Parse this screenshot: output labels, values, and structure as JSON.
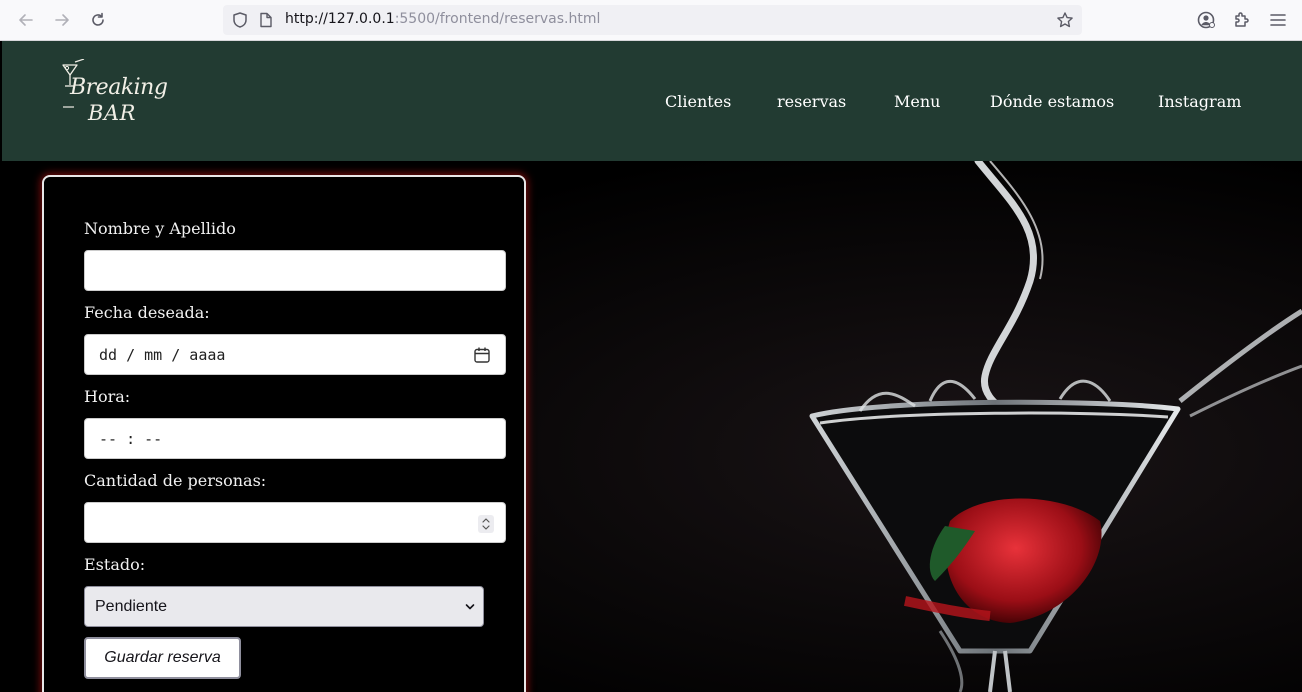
{
  "browser": {
    "url_host": "http://127.0.0.1",
    "url_path": ":5500/frontend/reservas.html"
  },
  "header": {
    "logo": {
      "line1": "Breaking",
      "line2": "BAR"
    },
    "nav": [
      "Clientes",
      "reservas",
      "Menu",
      "Dónde estamos",
      "Instagram"
    ]
  },
  "form": {
    "name_label": "Nombre y Apellido",
    "name_value": "",
    "date_label": "Fecha deseada:",
    "date_placeholder": "dd / mm / aaaa",
    "time_label": "Hora:",
    "time_placeholder": "-- : --",
    "people_label": "Cantidad de personas:",
    "people_value": "",
    "status_label": "Estado:",
    "status_value": "Pendiente",
    "save_label": "Guardar reserva"
  },
  "icons": {
    "back": "arrow-left-icon",
    "forward": "arrow-right-icon",
    "reload": "reload-icon",
    "shield": "shield-icon",
    "page": "page-icon",
    "bookmark": "star-icon",
    "account": "account-icon",
    "extensions": "puzzle-icon",
    "menu": "hamburger-icon",
    "calendar": "calendar-icon"
  },
  "colors": {
    "header_bg": "#223b32",
    "page_bg": "#000000",
    "card_glow": "#c81414"
  }
}
